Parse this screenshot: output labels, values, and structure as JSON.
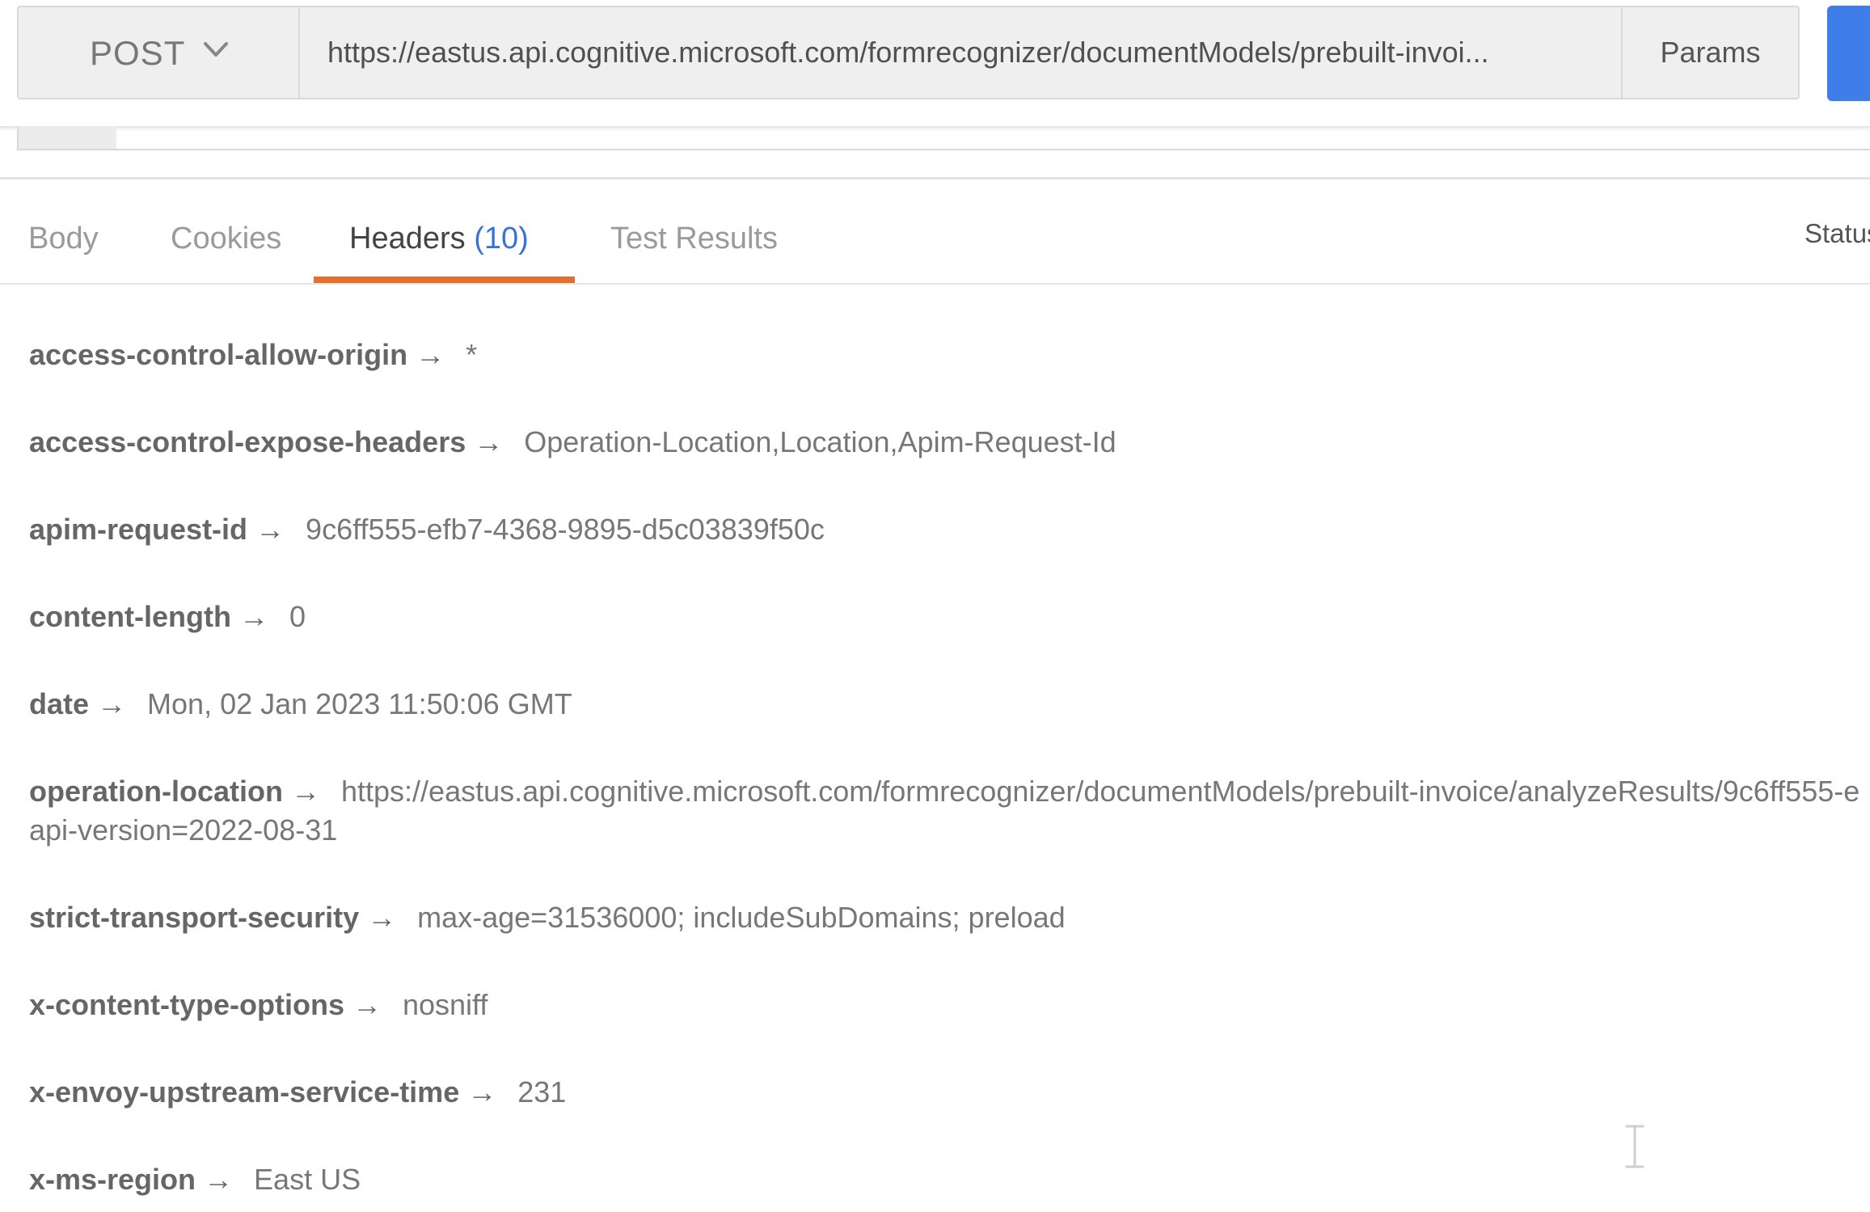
{
  "request": {
    "method": "POST",
    "url": "https://eastus.api.cognitive.microsoft.com/formrecognizer/documentModels/prebuilt-invoi...",
    "params_label": "Params"
  },
  "response": {
    "tabs": [
      {
        "label": "Body"
      },
      {
        "label": "Cookies"
      },
      {
        "label": "Headers",
        "count": "(10)",
        "active": true
      },
      {
        "label": "Test Results"
      }
    ],
    "status_label": "Status",
    "arrow": "→",
    "headers": [
      {
        "key": "access-control-allow-origin",
        "value": "*"
      },
      {
        "key": "access-control-expose-headers",
        "value": "Operation-Location,Location,Apim-Request-Id"
      },
      {
        "key": "apim-request-id",
        "value": "9c6ff555-efb7-4368-9895-d5c03839f50c"
      },
      {
        "key": "content-length",
        "value": "0"
      },
      {
        "key": "date",
        "value": "Mon, 02 Jan 2023 11:50:06 GMT"
      },
      {
        "key": "operation-location",
        "value": "https://eastus.api.cognitive.microsoft.com/formrecognizer/documentModels/prebuilt-invoice/analyzeResults/9c6ff555-e",
        "value_continued": "api-version=2022-08-31"
      },
      {
        "key": "strict-transport-security",
        "value": "max-age=31536000; includeSubDomains; preload"
      },
      {
        "key": "x-content-type-options",
        "value": "nosniff"
      },
      {
        "key": "x-envoy-upstream-service-time",
        "value": "231"
      },
      {
        "key": "x-ms-region",
        "value": "East US"
      }
    ]
  },
  "colors": {
    "accent_tab_underline": "#e0702f",
    "send_button": "#3f7de8",
    "header_count": "#3a73d8"
  },
  "icons": {
    "method_dropdown": "chevron-down-icon",
    "cursor": "text-cursor-icon"
  }
}
